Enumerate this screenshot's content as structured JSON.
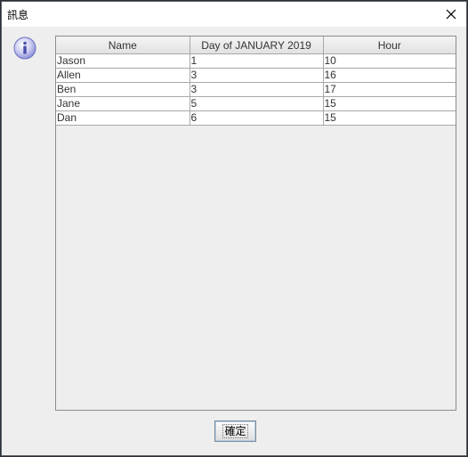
{
  "window": {
    "title": "訊息",
    "close_glyph": "✕"
  },
  "icon": {
    "name": "info-icon",
    "color": "#7b7fcf"
  },
  "table": {
    "columns": [
      "Name",
      "Day of JANUARY 2019",
      "Hour"
    ],
    "rows": [
      [
        "Jason",
        "1",
        "10"
      ],
      [
        "Allen",
        "3",
        "16"
      ],
      [
        "Ben",
        "3",
        "17"
      ],
      [
        "Jane",
        "5",
        "15"
      ],
      [
        "Dan",
        "6",
        "15"
      ]
    ]
  },
  "ok_button": {
    "label": "確定"
  }
}
